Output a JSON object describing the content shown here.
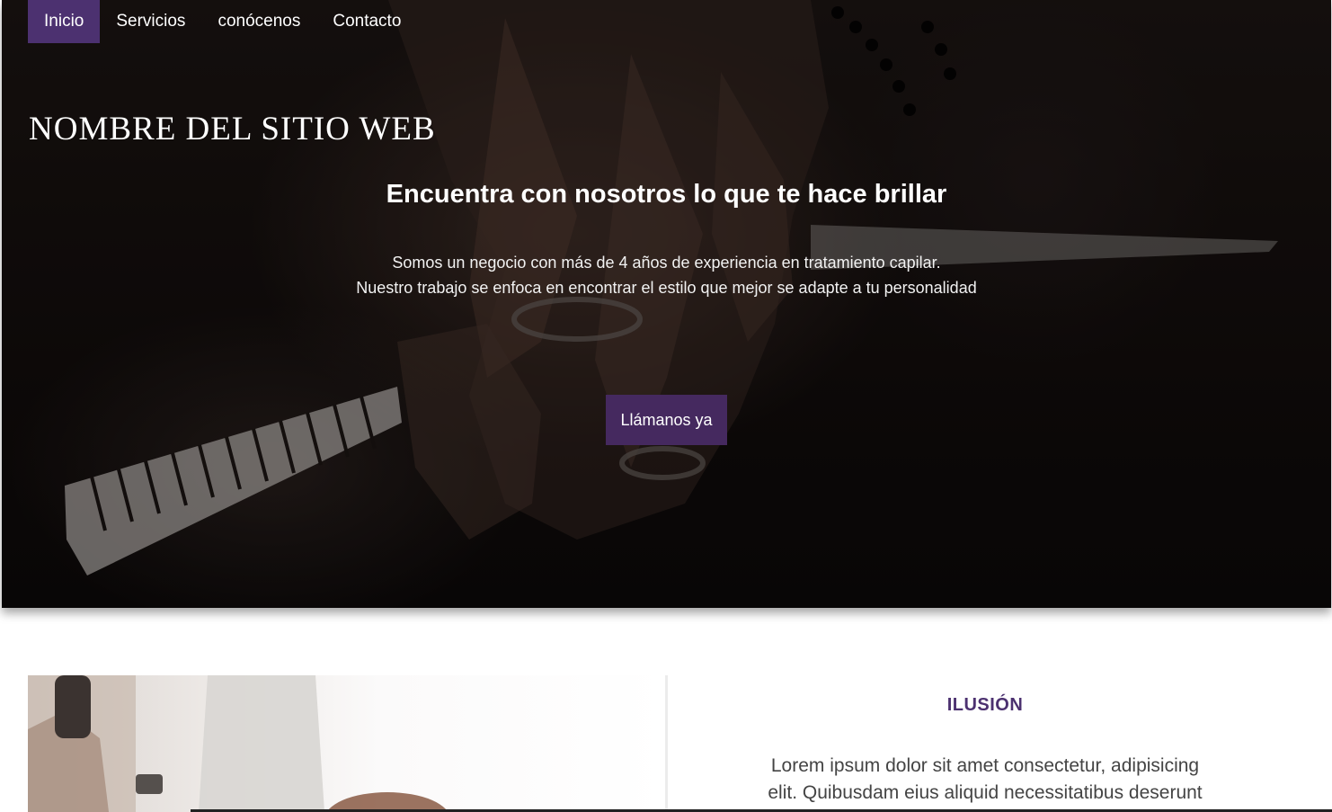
{
  "nav": {
    "items": [
      {
        "label": "Inicio",
        "active": true
      },
      {
        "label": "Servicios",
        "active": false
      },
      {
        "label": "conócenos",
        "active": false
      },
      {
        "label": "Contacto",
        "active": false
      }
    ]
  },
  "hero": {
    "site_title": "NOMBRE DEL SITIO WEB",
    "tagline": "Encuentra con nosotros lo que te hace brillar",
    "description_line1": "Somos un negocio con más de 4 años de experiencia en tratamiento capilar.",
    "description_line2": "Nuestro trabajo se enfoca en encontrar el estilo que mejor se adapte a tu personalidad",
    "cta_label": "Llámanos ya"
  },
  "feature": {
    "title": "ILUSIÓN",
    "text": "Lorem ipsum dolor sit amet consectetur, adipisicing elit. Quibusdam eius aliquid necessitatibus deserunt"
  },
  "colors": {
    "accent": "#4c3170",
    "button": "#45295f"
  }
}
